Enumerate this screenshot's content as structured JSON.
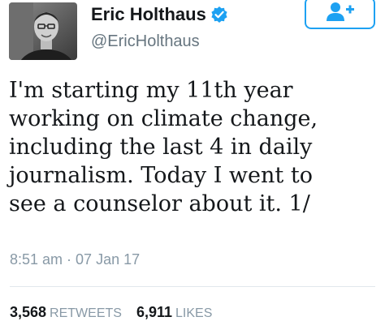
{
  "author": {
    "display_name": "Eric Holthaus",
    "handle": "@EricHolthaus",
    "verified": true
  },
  "follow_button": {
    "icon": "add-user-icon"
  },
  "tweet": {
    "lines": [
      "I'm starting my 11th year",
      "working on climate change,",
      "including the last 4 in daily",
      "journalism. Today I went to",
      "see a counselor about it. 1/"
    ]
  },
  "meta": {
    "time": "8:51 am",
    "separator": "·",
    "date": "07 Jan 17"
  },
  "stats": {
    "retweets_count": "3,568",
    "retweets_label": "RETWEETS",
    "likes_count": "6,911",
    "likes_label": "LIKES"
  },
  "colors": {
    "accent": "#1da1f2",
    "text": "#14171a",
    "muted": "#8899a6"
  }
}
